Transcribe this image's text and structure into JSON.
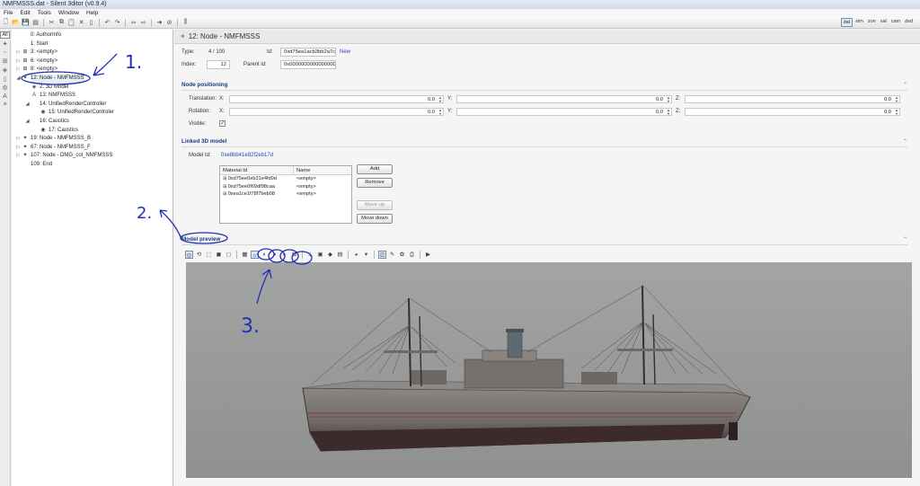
{
  "window": {
    "title": "NMFMSSS.dat - Silent 3ditor (v0.9.4)"
  },
  "menu": [
    "File",
    "Edit",
    "Tools",
    "Window",
    "Help"
  ],
  "view_modes": [
    "dat",
    "sim",
    "zon",
    "val",
    "cam",
    "dsd"
  ],
  "sidestrip": {
    "all_label": "All"
  },
  "tree": [
    {
      "label": "0: AuthorInfo",
      "indent": 0,
      "icon": "none",
      "expander": ""
    },
    {
      "label": "1: Start",
      "indent": 0,
      "icon": "none",
      "expander": ""
    },
    {
      "label": "3: <empty>",
      "indent": 0,
      "icon": "node-group",
      "expander": "▷"
    },
    {
      "label": "6: <empty>",
      "indent": 0,
      "icon": "node-group",
      "expander": "▷"
    },
    {
      "label": "8: <empty>",
      "indent": 0,
      "icon": "node-group",
      "expander": "▷"
    },
    {
      "label": "12: Node - NMFMSSS",
      "indent": 0,
      "icon": "node",
      "expander": "◢",
      "selected": true
    },
    {
      "label": "2: 3D Model",
      "indent": 1,
      "icon": "model",
      "expander": ""
    },
    {
      "label": "13: NMFMSSS",
      "indent": 1,
      "icon": "text",
      "expander": ""
    },
    {
      "label": "14: UnifiedRenderController",
      "indent": 1,
      "icon": "none",
      "expander": "◢"
    },
    {
      "label": "15: UnifiedRenderControler",
      "indent": 2,
      "icon": "controller",
      "expander": ""
    },
    {
      "label": "16: Caustics",
      "indent": 1,
      "icon": "none",
      "expander": "◢"
    },
    {
      "label": "17: Caustics",
      "indent": 2,
      "icon": "controller",
      "expander": ""
    },
    {
      "label": "19: Node - NMFMSSS_B",
      "indent": 0,
      "icon": "node",
      "expander": "▷"
    },
    {
      "label": "67: Node - NMFMSSS_F",
      "indent": 0,
      "icon": "node",
      "expander": "▷"
    },
    {
      "label": "107: Node - DMG_col_NMFMSSS",
      "indent": 0,
      "icon": "node",
      "expander": "▷"
    },
    {
      "label": "109: End",
      "indent": 0,
      "icon": "none",
      "expander": ""
    }
  ],
  "header": {
    "title": "12: Node - NMFMSSS"
  },
  "props": {
    "type_label": "Type:",
    "type_value": "4 / 100",
    "id_label": "Id:",
    "id_value": "0xd75ea1acb3bb2a7c",
    "new_label": "New",
    "index_label": "Index:",
    "index_value": "12",
    "parent_label": "Parent id:",
    "parent_value": "0x0000000000000000"
  },
  "positioning": {
    "title": "Node positioning",
    "translation_label": "Translation:",
    "rotation_label": "Rotation:",
    "visible_label": "Visible:",
    "x_label": "X:",
    "y_label": "Y:",
    "z_label": "Z:",
    "tx": "0,0",
    "ty": "0,0",
    "tz": "0,0",
    "rx": "0,0",
    "ry": "0,0",
    "rz": "0,0",
    "visible_checked": true
  },
  "linked_model": {
    "title": "Linked 3D model",
    "model_id_label": "Model Id:",
    "model_id_value": "0xe8bb41e82f2eb17d",
    "col_material": "Material Id",
    "col_name": "Name",
    "materials": [
      {
        "id": "0xd75ee0eb31e4fd0d",
        "name": "<empty>"
      },
      {
        "id": "0xd75ee0f69df98caa",
        "name": "<empty>"
      },
      {
        "id": "0xea1ce1f78f7beb08",
        "name": "<empty>"
      }
    ],
    "btn_add": "Add",
    "btn_remove": "Remove",
    "btn_move_up": "Move up",
    "btn_move_down": "Move down"
  },
  "preview": {
    "title": "Model preview"
  },
  "annotations": {
    "a1": "1.",
    "a2": "2.",
    "a3": "3."
  },
  "colors": {
    "section_title": "#1a3d7c",
    "annotation_ink": "#1f2fb4",
    "viewport_bg": "#9c9d9d"
  }
}
